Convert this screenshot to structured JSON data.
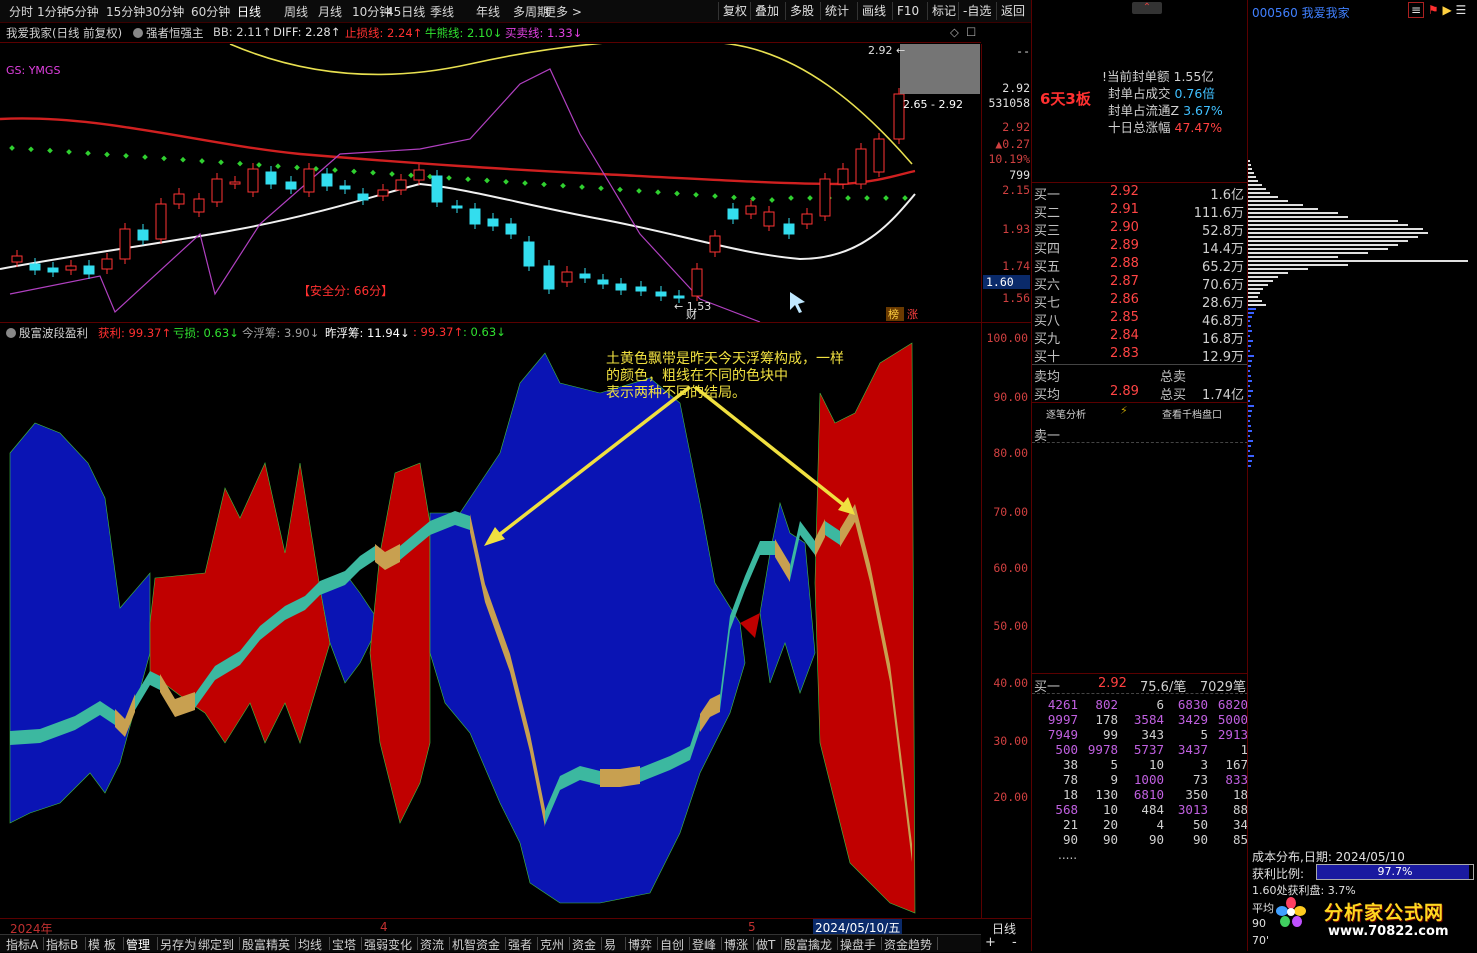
{
  "toolbar": {
    "periods": [
      "分时",
      "1分钟",
      "5分钟",
      "15分钟",
      "30分钟",
      "60分钟",
      "日线",
      "周线",
      "月线",
      "10分钟",
      "45日线",
      "季线",
      "年线",
      "多周期",
      "更多 >"
    ],
    "actions": [
      "复权",
      "叠加",
      "多股",
      "统计",
      "画线",
      "F10",
      "标记",
      "-自选",
      "返回"
    ]
  },
  "kline_header": {
    "stock": "我爱我家(日线 前复权)",
    "indicator": "强者恒强主",
    "bb": "BB: 2.11↑",
    "diff": "DIFF: 2.28↑",
    "stoploss": "止损线: 2.24↑",
    "bull": "牛熊线: 2.10↓",
    "buysell": "买卖线: 1.33↓",
    "gs": "GS: YMGS",
    "safety": "【安全分: 66分】",
    "low_mark": "← 1.53",
    "tag_cai": "财",
    "tag_bang": "榜",
    "tag_zhang": "涨",
    "hi_mark": "2.92 ←",
    "range": "2.65 - 2.92"
  },
  "kline_axis": [
    "2.92",
    "531058",
    "2.92",
    "▲0.27",
    "10.19%",
    "799",
    "2.15",
    "1.93",
    "1.74",
    "1.60",
    "1.56"
  ],
  "wave_header": {
    "name": "殷富波段盈利",
    "profit": "获利: 99.37↑",
    "loss": "亏损: 0.63↓",
    "today": "今浮筹: 3.90↓",
    "yesterday": "昨浮筹: 11.94↓",
    "v1": ": 99.37↑",
    "v2": ": 0.63↓"
  },
  "wave_axis": [
    "100.00",
    "90.00",
    "80.00",
    "70.00",
    "60.00",
    "50.00",
    "40.00",
    "30.00",
    "20.00"
  ],
  "annotation": {
    "line1": "土黄色飘带是昨天今天浮筹构成，一样",
    "line2": "的颜色，粗线在不同的色块中",
    "line3": "表示两种不同的结局。"
  },
  "date_axis": {
    "year": "2024年",
    "m4": "4",
    "m5": "5",
    "cursor_date": "2024/05/10/五",
    "period": "日线"
  },
  "right_panel": {
    "boards": "6天3板",
    "seal_amount_label": "!当前封单额",
    "seal_amount": "1.55亿",
    "seal_vol_label": "封单占成交",
    "seal_vol": "0.76倍",
    "seal_float_label": "封单占流通Z",
    "seal_float": "3.67%",
    "ten_day_label": "十日总涨幅",
    "ten_day": "47.47%",
    "bids": [
      {
        "label": "买一",
        "price": "2.92",
        "vol": "1.6亿"
      },
      {
        "label": "买二",
        "price": "2.91",
        "vol": "111.6万"
      },
      {
        "label": "买三",
        "price": "2.90",
        "vol": "52.8万"
      },
      {
        "label": "买四",
        "price": "2.89",
        "vol": "14.4万"
      },
      {
        "label": "买五",
        "price": "2.88",
        "vol": "65.2万"
      },
      {
        "label": "买六",
        "price": "2.87",
        "vol": "70.6万"
      },
      {
        "label": "买七",
        "price": "2.86",
        "vol": "28.6万"
      },
      {
        "label": "买八",
        "price": "2.85",
        "vol": "46.8万"
      },
      {
        "label": "买九",
        "price": "2.84",
        "vol": "16.8万"
      },
      {
        "label": "买十",
        "price": "2.83",
        "vol": "12.9万"
      }
    ],
    "sell_avg_label": "卖均",
    "sell_total_label": "总卖",
    "buy_avg_label": "买均",
    "buy_avg": "2.89",
    "buy_total_label": "总买",
    "buy_total": "1.74亿",
    "btn_trades": "逐笔分析",
    "btn_thousand": "查看千档盘口",
    "sell1_label": "卖一",
    "queue_head": {
      "label": "买一",
      "price": "2.92",
      "avg": "75.6/笔",
      "count": "7029笔"
    },
    "queue": [
      [
        "4261",
        "802",
        "6",
        "6830",
        "6820"
      ],
      [
        "9997",
        "178",
        "3584",
        "3429",
        "5000"
      ],
      [
        "7949",
        "99",
        "343",
        "5",
        "2913"
      ],
      [
        "500",
        "9978",
        "5737",
        "3437",
        "1"
      ],
      [
        "38",
        "5",
        "10",
        "3",
        "167"
      ],
      [
        "78",
        "9",
        "1000",
        "73",
        "833"
      ],
      [
        "18",
        "130",
        "6810",
        "350",
        "18"
      ],
      [
        "568",
        "10",
        "484",
        "3013",
        "88"
      ],
      [
        "21",
        "20",
        "4",
        "50",
        "34"
      ],
      [
        "90",
        "90",
        "90",
        "90",
        "85"
      ]
    ],
    "more": "....."
  },
  "far_right": {
    "code_name": "000560 我爱我家",
    "cost_dist": "成本分布,日期: 2024/05/10",
    "profit_ratio_label": "获利比例:",
    "profit_ratio": "97.7%",
    "profit_ratio_value": 0.977,
    "outside_label": "1.60处获利盘: 3.7%",
    "avg_label": "平均",
    "p90_label": "90",
    "p70_label": "70'",
    "watermark": "分析家公式网",
    "watermark_url": "www.70822.com"
  },
  "tabs": [
    "指标A",
    "指标B",
    "模 板",
    "管理",
    "另存为",
    "绑定到",
    "殷富精英",
    "均线",
    "宝塔",
    "强弱变化",
    "资流",
    "机智资金",
    "强者",
    "克州",
    "资金",
    "易",
    "博弈",
    "自创",
    "登峰",
    "博涨",
    "做T",
    "殷富擒龙",
    "操盘手",
    "资金趋势"
  ],
  "colors": {
    "up": "#ff3333",
    "down": "#33ddee",
    "blue": "#0a14b4",
    "red": "#c00000",
    "ribbon_gold": "#c8a050",
    "ribbon_teal": "#3cb8a0",
    "yellow": "#f0e040"
  }
}
